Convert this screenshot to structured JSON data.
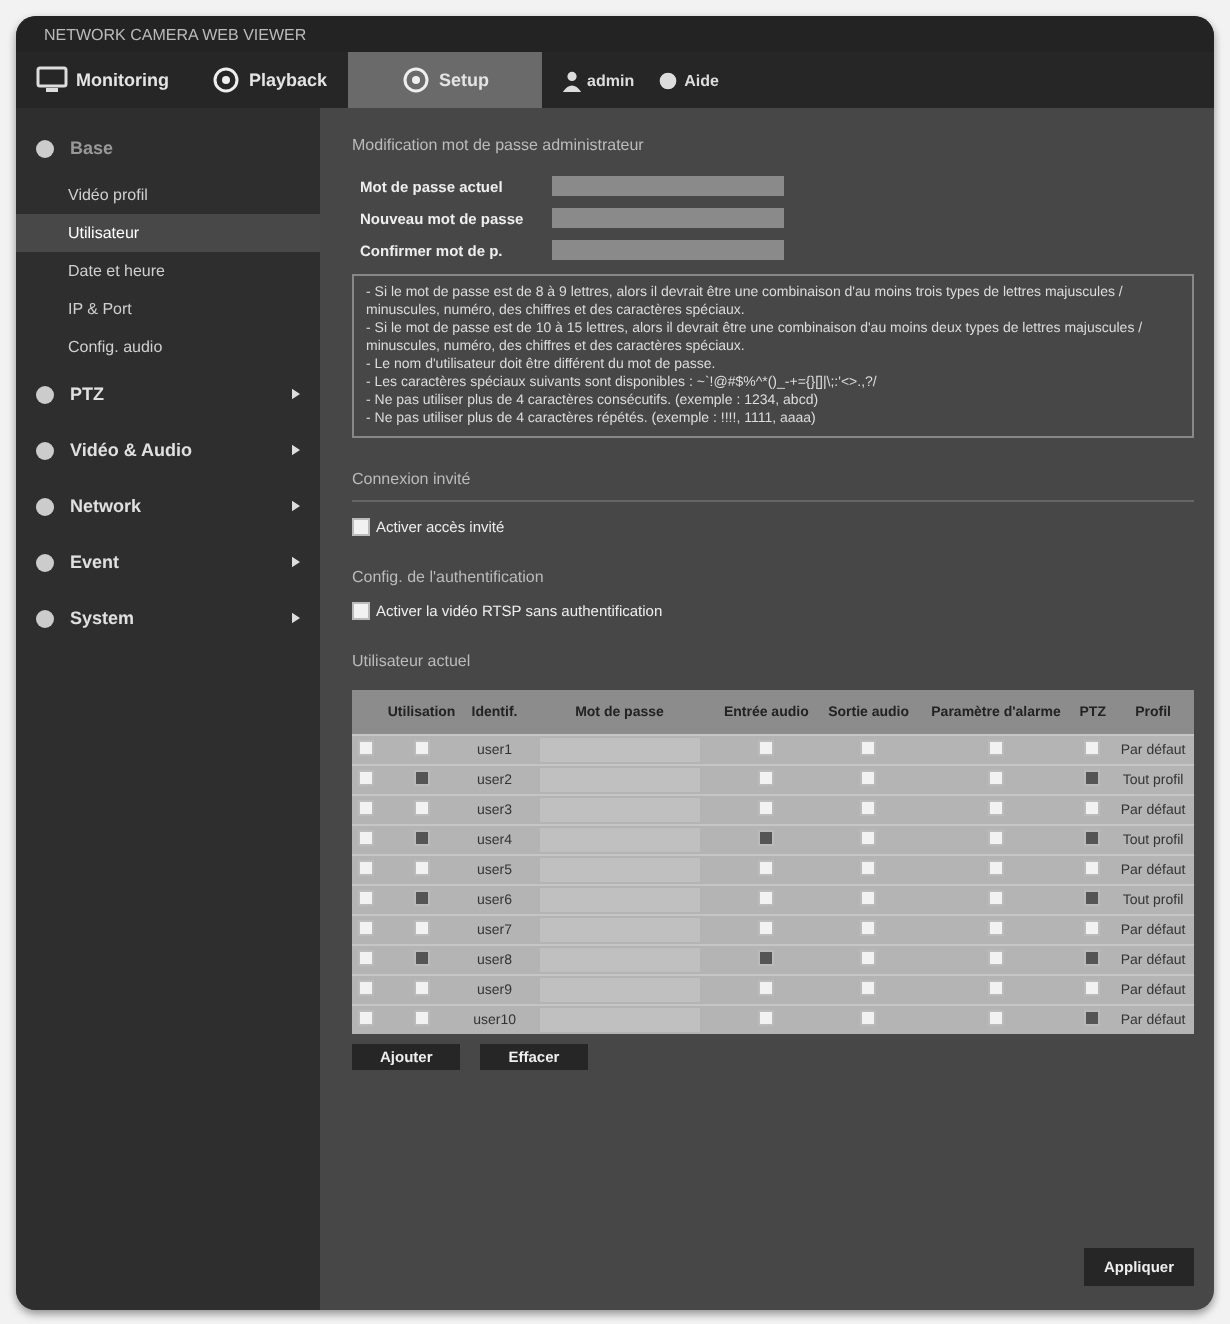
{
  "window": {
    "title": "NETWORK CAMERA WEB VIEWER"
  },
  "top_tabs": [
    {
      "label": "Monitoring",
      "selected": false
    },
    {
      "label": "Playback",
      "selected": false
    },
    {
      "label": "Setup",
      "selected": true
    }
  ],
  "user_menu": [
    {
      "label": "admin"
    },
    {
      "label": "Aide"
    }
  ],
  "sidebar": {
    "items": [
      {
        "label": "Base",
        "expanded": true,
        "children": [
          {
            "label": "Vidéo profil",
            "selected": false
          },
          {
            "label": "Utilisateur",
            "selected": true
          },
          {
            "label": "Date et heure",
            "selected": false
          },
          {
            "label": "IP & Port",
            "selected": false
          },
          {
            "label": "Config. audio",
            "selected": false
          }
        ]
      },
      {
        "label": "PTZ",
        "expanded": false
      },
      {
        "label": "Vidéo & Audio",
        "expanded": false
      },
      {
        "label": "Network",
        "expanded": false
      },
      {
        "label": "Event",
        "expanded": false
      },
      {
        "label": "System",
        "expanded": false
      }
    ]
  },
  "password_section": {
    "title": "Modification mot de passe administrateur",
    "fields": [
      {
        "label": "Mot de passe actuel"
      },
      {
        "label": "Nouveau mot de passe"
      },
      {
        "label": "Confirmer mot de p."
      }
    ],
    "notes": [
      "- Si le mot de passe est de 8 à 9 lettres, alors il devrait être une combinaison d'au moins trois types de lettres majuscules / minuscules, numéro, des chiffres et des caractères spéciaux.",
      "- Si le mot de passe est de 10 à 15 lettres, alors il devrait être une combinaison d'au moins deux types de lettres majuscules / minuscules, numéro, des chiffres et des caractères spéciaux.",
      "- Le nom d'utilisateur doit être différent du mot de passe.",
      "- Les caractères spéciaux suivants sont disponibles : ~`!@#$%^*()_-+={}[]|\\;:'<>.,?/",
      "- Ne pas utiliser plus de 4 caractères consécutifs. (exemple : 1234, abcd)",
      "- Ne pas utiliser plus de 4 caractères répétés. (exemple : !!!!, 1111, aaaa)"
    ]
  },
  "guest_section": {
    "title": "Connexion invité",
    "option": {
      "label": "Activer accès invité",
      "checked": false
    }
  },
  "auth_section": {
    "title": "Config. de l'authentification",
    "option": {
      "label": "Activer la vidéo RTSP sans authentification",
      "checked": false
    }
  },
  "users_section": {
    "title": "Utilisateur actuel",
    "columns": [
      "Utilisation",
      "Identif.",
      "Mot de passe",
      "Entrée audio",
      "Sortie audio",
      "Paramètre d'alarme",
      "PTZ",
      "Profil"
    ],
    "rows": [
      {
        "selected": false,
        "use": false,
        "id": "user1",
        "audio_in": false,
        "audio_out": false,
        "alarm": false,
        "ptz": false,
        "profile": "Par défaut"
      },
      {
        "selected": false,
        "use": true,
        "id": "user2",
        "audio_in": false,
        "audio_out": false,
        "alarm": false,
        "ptz": true,
        "profile": "Tout profil"
      },
      {
        "selected": false,
        "use": false,
        "id": "user3",
        "audio_in": false,
        "audio_out": false,
        "alarm": false,
        "ptz": false,
        "profile": "Par défaut"
      },
      {
        "selected": false,
        "use": true,
        "id": "user4",
        "audio_in": true,
        "audio_out": false,
        "alarm": false,
        "ptz": true,
        "profile": "Tout profil"
      },
      {
        "selected": false,
        "use": false,
        "id": "user5",
        "audio_in": false,
        "audio_out": false,
        "alarm": false,
        "ptz": false,
        "profile": "Par défaut"
      },
      {
        "selected": false,
        "use": true,
        "id": "user6",
        "audio_in": false,
        "audio_out": false,
        "alarm": false,
        "ptz": true,
        "profile": "Tout profil"
      },
      {
        "selected": false,
        "use": false,
        "id": "user7",
        "audio_in": false,
        "audio_out": false,
        "alarm": false,
        "ptz": false,
        "profile": "Par défaut"
      },
      {
        "selected": false,
        "use": true,
        "id": "user8",
        "audio_in": true,
        "audio_out": false,
        "alarm": false,
        "ptz": true,
        "profile": "Par défaut"
      },
      {
        "selected": false,
        "use": false,
        "id": "user9",
        "audio_in": false,
        "audio_out": false,
        "alarm": false,
        "ptz": false,
        "profile": "Par défaut"
      },
      {
        "selected": false,
        "use": false,
        "id": "user10",
        "audio_in": false,
        "audio_out": false,
        "alarm": false,
        "ptz": true,
        "profile": "Par défaut"
      }
    ],
    "buttons": [
      "Ajouter",
      "Effacer"
    ]
  },
  "apply_button": "Appliquer"
}
